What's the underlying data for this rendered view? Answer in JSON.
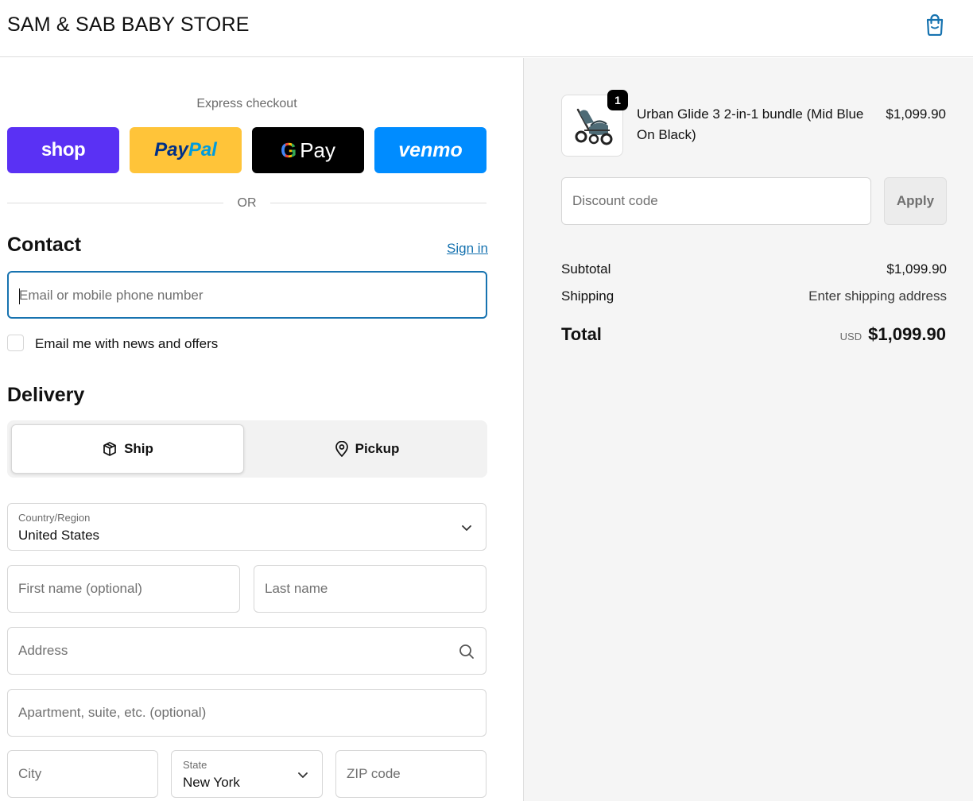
{
  "header": {
    "store_name": "SAM & SAB BABY STORE"
  },
  "express": {
    "label": "Express checkout",
    "buttons": [
      "shop",
      "PayPal",
      "G Pay",
      "venmo"
    ],
    "or": "OR"
  },
  "contact": {
    "title": "Contact",
    "signin": "Sign in",
    "email_placeholder": "Email or mobile phone number",
    "newsletter_label": "Email me with news and offers"
  },
  "delivery": {
    "title": "Delivery",
    "ship": "Ship",
    "pickup": "Pickup",
    "country_label": "Country/Region",
    "country_value": "United States",
    "first_name_placeholder": "First name (optional)",
    "last_name_placeholder": "Last name",
    "address_placeholder": "Address",
    "apartment_placeholder": "Apartment, suite, etc. (optional)",
    "city_placeholder": "City",
    "state_label": "State",
    "state_value": "New York",
    "zip_placeholder": "ZIP code"
  },
  "summary": {
    "product_name": "Urban Glide 3 2-in-1 bundle (Mid Blue On Black)",
    "product_price": "$1,099.90",
    "quantity": "1",
    "discount_placeholder": "Discount code",
    "apply": "Apply",
    "subtotal_label": "Subtotal",
    "subtotal_value": "$1,099.90",
    "shipping_label": "Shipping",
    "shipping_value": "Enter shipping address",
    "total_label": "Total",
    "total_currency": "USD",
    "total_value": "$1,099.90"
  },
  "colors": {
    "shop": "#5a31f4",
    "paypal": "#ffc439",
    "gpay": "#000000",
    "venmo": "#008cff",
    "link": "#1773b0"
  }
}
